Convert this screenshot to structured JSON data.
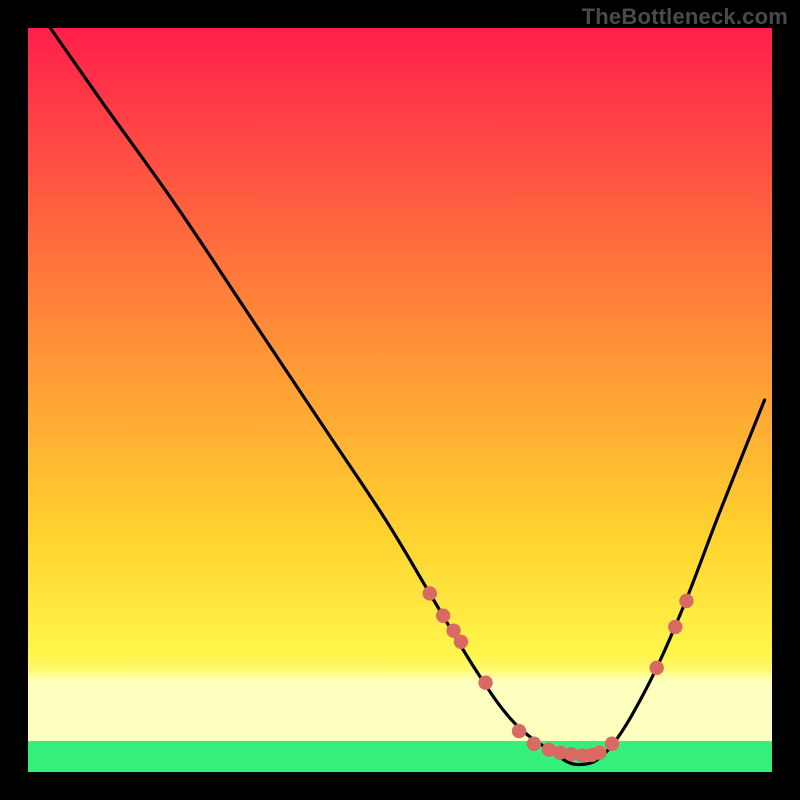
{
  "watermark": "TheBottleneck.com",
  "chart_data": {
    "type": "line",
    "title": "",
    "xlabel": "",
    "ylabel": "",
    "xlim": [
      0,
      100
    ],
    "ylim": [
      0,
      100
    ],
    "series": [
      {
        "name": "bottleneck-curve",
        "x": [
          3,
          10,
          20,
          30,
          40,
          48,
          54,
          60,
          65,
          70,
          74,
          78,
          83,
          88,
          93,
          99
        ],
        "values": [
          100,
          90,
          76,
          61,
          46,
          34,
          24,
          14,
          7,
          3,
          1,
          3,
          11,
          22,
          35,
          50
        ]
      }
    ],
    "marker_points": {
      "name": "highlighted-points",
      "x": [
        54.0,
        55.8,
        57.2,
        58.2,
        61.5,
        66.0,
        68.0,
        70.0,
        71.5,
        73.0,
        74.5,
        75.8,
        76.8,
        78.5,
        84.5,
        87.0,
        88.5
      ],
      "values": [
        24.0,
        21.0,
        19.0,
        17.5,
        12.0,
        5.5,
        3.8,
        3.0,
        2.6,
        2.4,
        2.2,
        2.3,
        2.6,
        3.8,
        14.0,
        19.5,
        23.0
      ]
    },
    "background": {
      "type": "vertical-gradient",
      "stops": [
        {
          "pos": 0.0,
          "color": "#ff1f4a"
        },
        {
          "pos": 0.28,
          "color": "#ff6a3e"
        },
        {
          "pos": 0.68,
          "color": "#ffd22f"
        },
        {
          "pos": 0.88,
          "color": "#fdffbf"
        },
        {
          "pos": 0.96,
          "color": "#35ef7d"
        },
        {
          "pos": 1.0,
          "color": "#35ef7d"
        }
      ]
    }
  }
}
